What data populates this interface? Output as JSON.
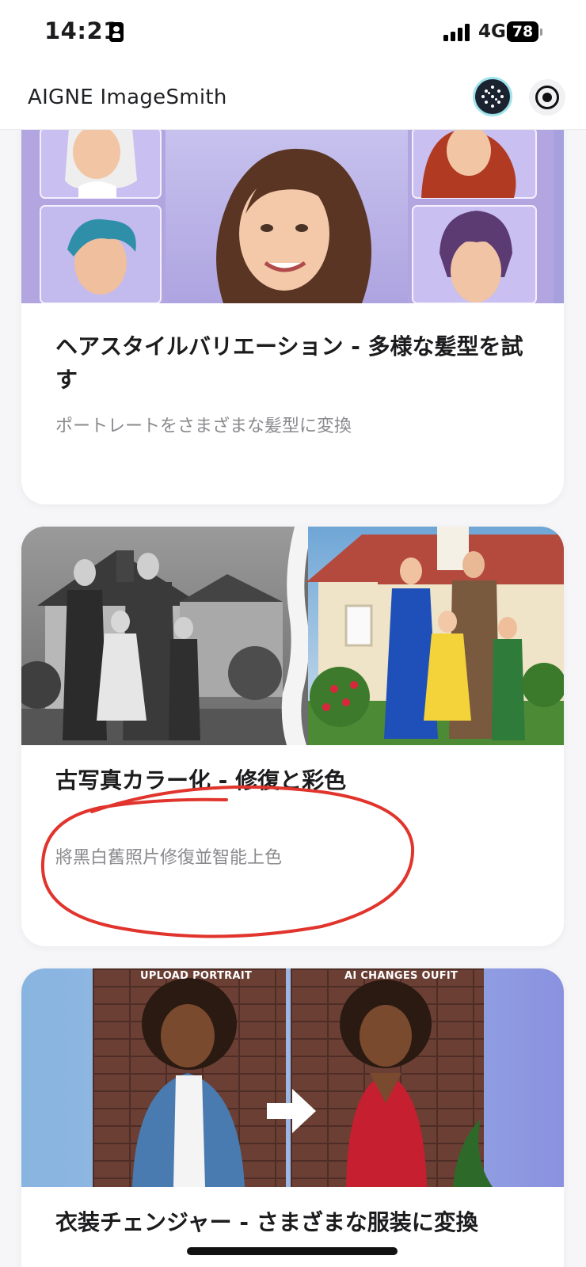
{
  "status_bar": {
    "time": "14:21",
    "network": "4G",
    "battery": "78"
  },
  "header": {
    "title": "AIGNE ImageSmith",
    "logo_icon": "aigne-logo-icon",
    "record_icon": "record-icon"
  },
  "cards": [
    {
      "title": "ヘアスタイルバリエーション - 多様な髪型を試す",
      "description": "ポートレートをさまざまな髪型に変換"
    },
    {
      "title": "古写真カラー化 - 修復と彩色",
      "description": "將黑白舊照片修復並智能上色"
    },
    {
      "title": "衣装チェンジャー - さまざまな服装に変換",
      "image_captions": [
        "UPLOAD PORTRAIT",
        "AI CHANGES OUFIT"
      ]
    }
  ],
  "colors": {
    "accent_annotation": "#e0342c",
    "background": "#f6f6f8",
    "card": "#ffffff"
  }
}
